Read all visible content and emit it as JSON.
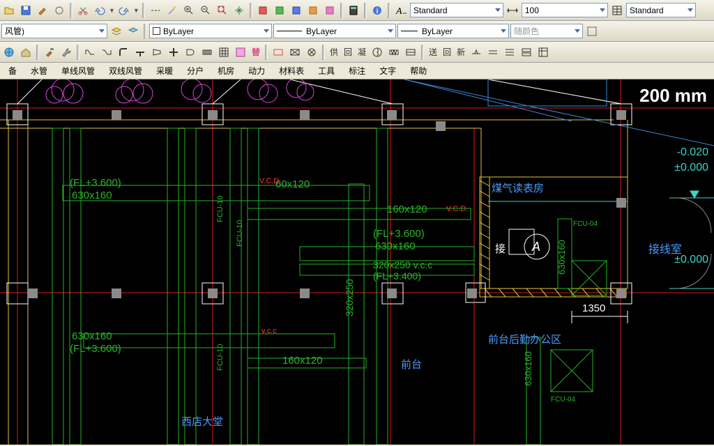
{
  "toolbar": {
    "text_style": "Standard",
    "dim_value": "100",
    "std2": "Standard",
    "layer_value": "风管)",
    "color_label": "ByLayer",
    "ltype_label": "ByLayer",
    "lweight_label": "ByLayer",
    "followcolor": "随颜色"
  },
  "panel": {
    "labels": [
      "供",
      "回",
      "凝",
      "送",
      "回",
      "新"
    ],
    "subs": [
      "替"
    ]
  },
  "menu": {
    "items": [
      "备",
      "水管",
      "单线风管",
      "双线风管",
      "采暖",
      "分户",
      "机房",
      "动力",
      "材料表",
      "工具",
      "标注",
      "文字",
      "帮助"
    ]
  },
  "drawing": {
    "big_label": "200 mm",
    "elev1": "-0.020",
    "elev2": "±0.000",
    "elev3": "±0.000",
    "rm_meter": "煤气读表房",
    "rm_wiring": "接线室",
    "rm_front": "前台",
    "rm_back": "前台后勤办公区",
    "rm_lobby": "西店大堂",
    "bubble": "A",
    "bubble_side": "接",
    "dim_1350": "1350",
    "fl36": "(FL+3.600)",
    "d630x160": "630x160",
    "d60x120": "60x120",
    "d160x120": "160x120",
    "d320x250": "320x250",
    "d320x250vcc": "320x250 v.c.c",
    "fl34": "(FL+3.400)",
    "vcc": "v.c.c",
    "vcc2": "V.C.D.",
    "fcu10": "FCU-10",
    "fcu04": "FCU-04"
  }
}
